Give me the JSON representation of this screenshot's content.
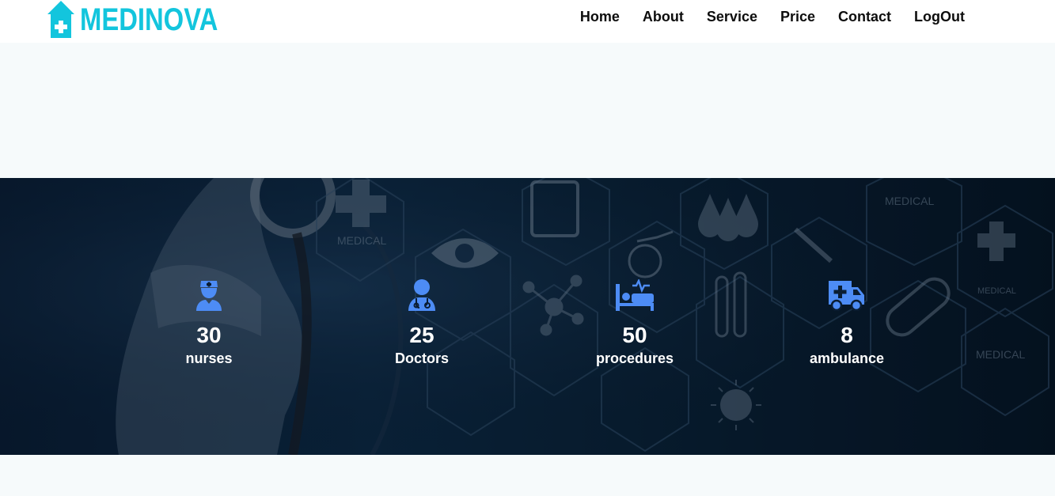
{
  "brand": {
    "name": "MEDINOVA",
    "icon": "hospital-house-icon",
    "color": "#13c5dd"
  },
  "nav": [
    {
      "label": "Home"
    },
    {
      "label": "About"
    },
    {
      "label": "Service"
    },
    {
      "label": "Price"
    },
    {
      "label": "Contact"
    },
    {
      "label": "LogOut"
    }
  ],
  "stats": [
    {
      "value": "30",
      "label": "nurses",
      "icon": "nurse-icon"
    },
    {
      "value": "25",
      "label": "Doctors",
      "icon": "doctor-icon"
    },
    {
      "value": "50",
      "label": "procedures",
      "icon": "hospital-bed-icon"
    },
    {
      "value": "8",
      "label": "ambulance",
      "icon": "ambulance-icon"
    }
  ],
  "background_labels": [
    "MEDICAL",
    "MEDICAL",
    "MEDICAL",
    "MEDICAL"
  ],
  "colors": {
    "accent_icon": "#4d8cf5",
    "band_dark": "#0a1d33",
    "page_bg": "#f6fafb"
  }
}
